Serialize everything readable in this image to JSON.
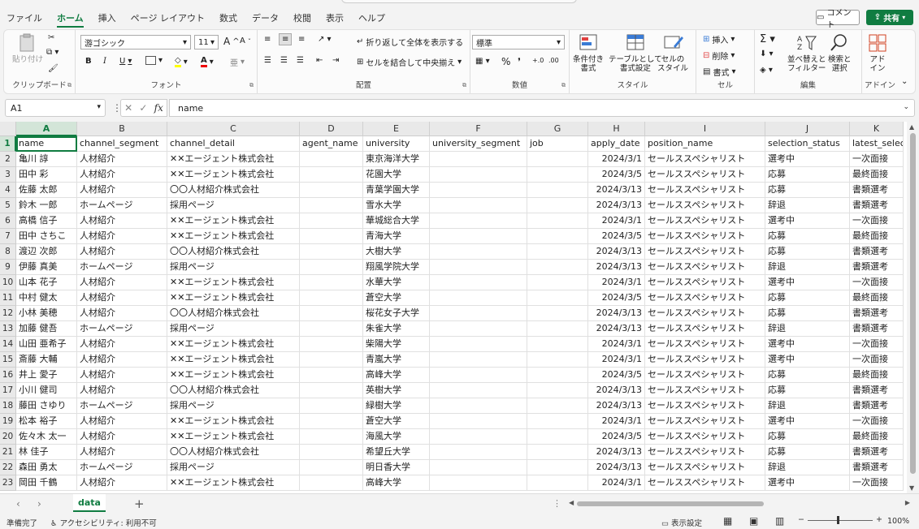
{
  "menu": {
    "tabs": [
      "ファイル",
      "ホーム",
      "挿入",
      "ページ レイアウト",
      "数式",
      "データ",
      "校閲",
      "表示",
      "ヘルプ"
    ],
    "active": "ホーム",
    "comment_label": "コメント",
    "share_label": "共有"
  },
  "ribbon": {
    "clipboard": {
      "label": "クリップボード",
      "paste": "貼り付け"
    },
    "font": {
      "label": "フォント",
      "name": "游ゴシック",
      "size": "11",
      "grow": "A",
      "shrink": "A",
      "bold": "B",
      "italic": "I",
      "underline": "U"
    },
    "alignment": {
      "label": "配置",
      "wrap": "折り返して全体を表示する",
      "merge": "セルを結合して中央揃え"
    },
    "number": {
      "label": "数値",
      "format": "標準"
    },
    "styles": {
      "label": "スタイル",
      "conditional": "条件付き\n書式",
      "table": "テーブルとして\n書式設定",
      "cell": "セルの\nスタイル"
    },
    "cells": {
      "label": "セル",
      "insert": "挿入",
      "delete": "削除",
      "format": "書式"
    },
    "editing": {
      "label": "編集",
      "sort": "並べ替えと\nフィルター",
      "find": "検索と\n選択"
    },
    "addins": {
      "label": "アドイン",
      "addin": "アド\nイン"
    }
  },
  "formula_bar": {
    "name_box": "A1",
    "content": "name",
    "fx": "fx"
  },
  "columns": [
    {
      "letter": "A",
      "header": "name"
    },
    {
      "letter": "B",
      "header": "channel_segment"
    },
    {
      "letter": "C",
      "header": "channel_detail"
    },
    {
      "letter": "D",
      "header": "agent_name"
    },
    {
      "letter": "E",
      "header": "university"
    },
    {
      "letter": "F",
      "header": "university_segment"
    },
    {
      "letter": "G",
      "header": "job"
    },
    {
      "letter": "H",
      "header": "apply_date"
    },
    {
      "letter": "I",
      "header": "position_name"
    },
    {
      "letter": "J",
      "header": "selection_status"
    },
    {
      "letter": "K",
      "header": "latest_selec"
    }
  ],
  "rows": [
    [
      "亀川 諄",
      "人材紹介",
      "✕✕エージェント株式会社",
      "",
      "東京海洋大学",
      "",
      "",
      "2024/3/1",
      "セールススペシャリスト",
      "選考中",
      "一次面接"
    ],
    [
      "田中 彩",
      "人材紹介",
      "✕✕エージェント株式会社",
      "",
      "花園大学",
      "",
      "",
      "2024/3/5",
      "セールススペシャリスト",
      "応募",
      "最終面接"
    ],
    [
      "佐藤 太郎",
      "人材紹介",
      "〇〇人材紹介株式会社",
      "",
      "青葉学園大学",
      "",
      "",
      "2024/3/13",
      "セールススペシャリスト",
      "応募",
      "書類選考"
    ],
    [
      "鈴木 一郎",
      "ホームページ",
      "採用ページ",
      "",
      "雪水大学",
      "",
      "",
      "2024/3/13",
      "セールススペシャリスト",
      "辞退",
      "書類選考"
    ],
    [
      "高橋 信子",
      "人材紹介",
      "✕✕エージェント株式会社",
      "",
      "華城総合大学",
      "",
      "",
      "2024/3/1",
      "セールススペシャリスト",
      "選考中",
      "一次面接"
    ],
    [
      "田中 さちこ",
      "人材紹介",
      "✕✕エージェント株式会社",
      "",
      "青海大学",
      "",
      "",
      "2024/3/5",
      "セールススペシャリスト",
      "応募",
      "最終面接"
    ],
    [
      "渡辺 次郎",
      "人材紹介",
      "〇〇人材紹介株式会社",
      "",
      "大樹大学",
      "",
      "",
      "2024/3/13",
      "セールススペシャリスト",
      "応募",
      "書類選考"
    ],
    [
      "伊藤 真美",
      "ホームページ",
      "採用ページ",
      "",
      "翔風学院大学",
      "",
      "",
      "2024/3/13",
      "セールススペシャリスト",
      "辞退",
      "書類選考"
    ],
    [
      "山本 花子",
      "人材紹介",
      "✕✕エージェント株式会社",
      "",
      "水華大学",
      "",
      "",
      "2024/3/1",
      "セールススペシャリスト",
      "選考中",
      "一次面接"
    ],
    [
      "中村 健太",
      "人材紹介",
      "✕✕エージェント株式会社",
      "",
      "蒼空大学",
      "",
      "",
      "2024/3/5",
      "セールススペシャリスト",
      "応募",
      "最終面接"
    ],
    [
      "小林 美穂",
      "人材紹介",
      "〇〇人材紹介株式会社",
      "",
      "桜花女子大学",
      "",
      "",
      "2024/3/13",
      "セールススペシャリスト",
      "応募",
      "書類選考"
    ],
    [
      "加藤 健吾",
      "ホームページ",
      "採用ページ",
      "",
      "朱雀大学",
      "",
      "",
      "2024/3/13",
      "セールススペシャリスト",
      "辞退",
      "書類選考"
    ],
    [
      "山田 亜希子",
      "人材紹介",
      "✕✕エージェント株式会社",
      "",
      "柴陽大学",
      "",
      "",
      "2024/3/1",
      "セールススペシャリスト",
      "選考中",
      "一次面接"
    ],
    [
      "斎藤 大輔",
      "人材紹介",
      "✕✕エージェント株式会社",
      "",
      "青嵐大学",
      "",
      "",
      "2024/3/1",
      "セールススペシャリスト",
      "選考中",
      "一次面接"
    ],
    [
      "井上 愛子",
      "人材紹介",
      "✕✕エージェント株式会社",
      "",
      "高峰大学",
      "",
      "",
      "2024/3/5",
      "セールススペシャリスト",
      "応募",
      "最終面接"
    ],
    [
      "小川 健司",
      "人材紹介",
      "〇〇人材紹介株式会社",
      "",
      "英樹大学",
      "",
      "",
      "2024/3/13",
      "セールススペシャリスト",
      "応募",
      "書類選考"
    ],
    [
      "藤田 さゆり",
      "ホームページ",
      "採用ページ",
      "",
      "緑樹大学",
      "",
      "",
      "2024/3/13",
      "セールススペシャリスト",
      "辞退",
      "書類選考"
    ],
    [
      "松本 裕子",
      "人材紹介",
      "✕✕エージェント株式会社",
      "",
      "蒼空大学",
      "",
      "",
      "2024/3/1",
      "セールススペシャリスト",
      "選考中",
      "一次面接"
    ],
    [
      "佐々木 太一",
      "人材紹介",
      "✕✕エージェント株式会社",
      "",
      "海風大学",
      "",
      "",
      "2024/3/5",
      "セールススペシャリスト",
      "応募",
      "最終面接"
    ],
    [
      "林 佳子",
      "人材紹介",
      "〇〇人材紹介株式会社",
      "",
      "希望丘大学",
      "",
      "",
      "2024/3/13",
      "セールススペシャリスト",
      "応募",
      "書類選考"
    ],
    [
      "森田 勇太",
      "ホームページ",
      "採用ページ",
      "",
      "明日香大学",
      "",
      "",
      "2024/3/13",
      "セールススペシャリスト",
      "辞退",
      "書類選考"
    ],
    [
      "岡田 千鶴",
      "人材紹介",
      "✕✕エージェント株式会社",
      "",
      "高峰大学",
      "",
      "",
      "2024/3/1",
      "セールススペシャリスト",
      "選考中",
      "一次面接"
    ]
  ],
  "sheet_tabs": [
    "data"
  ],
  "status": {
    "ready": "準備完了",
    "accessibility": "アクセシビリティ: 利用不可",
    "display_settings": "表示設定",
    "zoom": "100%"
  }
}
